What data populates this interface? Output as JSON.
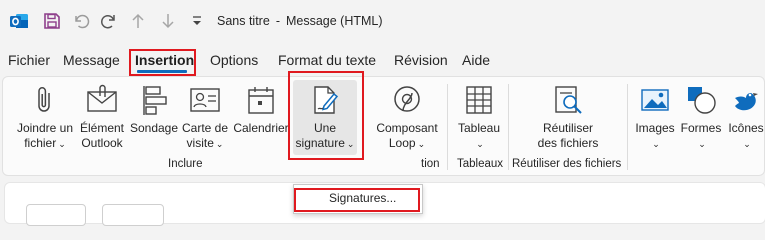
{
  "window": {
    "title_doc": "Sans titre",
    "title_sep": "-",
    "title_app": "Message (HTML)"
  },
  "quick_access": {
    "icons": [
      "outlook-icon",
      "save-icon",
      "undo-icon",
      "redo-icon",
      "arrow-up-icon",
      "arrow-down-icon",
      "customize-icon"
    ]
  },
  "menu": {
    "tabs": [
      "Fichier",
      "Message",
      "Insertion",
      "Options",
      "Format du texte",
      "Révision",
      "Aide"
    ],
    "active": "Insertion"
  },
  "ribbon": {
    "include": {
      "label": "Inclure",
      "attach_l1": "Joindre un",
      "attach_l2": "fichier",
      "outlook_l1": "Élément",
      "outlook_l2": "Outlook",
      "poll": "Sondage",
      "card_l1": "Carte de",
      "card_l2": "visite",
      "calendar": "Calendrier",
      "signature_l1": "Une",
      "signature_l2": "signature",
      "component_l1": "Composant",
      "component_l2": "Loop",
      "group_tail": "tion"
    },
    "tables": {
      "label": "Tableaux",
      "table": "Tableau"
    },
    "reuse": {
      "label": "Réutiliser des fichiers",
      "reuse_l1": "Réutiliser",
      "reuse_l2": "des fichiers"
    },
    "illustrations": {
      "images": "Images",
      "shapes": "Formes",
      "icons": "Icônes"
    },
    "caret": "⌄"
  },
  "signature_menu": {
    "item": "Signatures..."
  },
  "colors": {
    "accent": "#0f6cbd",
    "highlight": "#e0191f",
    "outlook_blue": "#0f6cbd",
    "save_purple": "#8e3f8b"
  }
}
